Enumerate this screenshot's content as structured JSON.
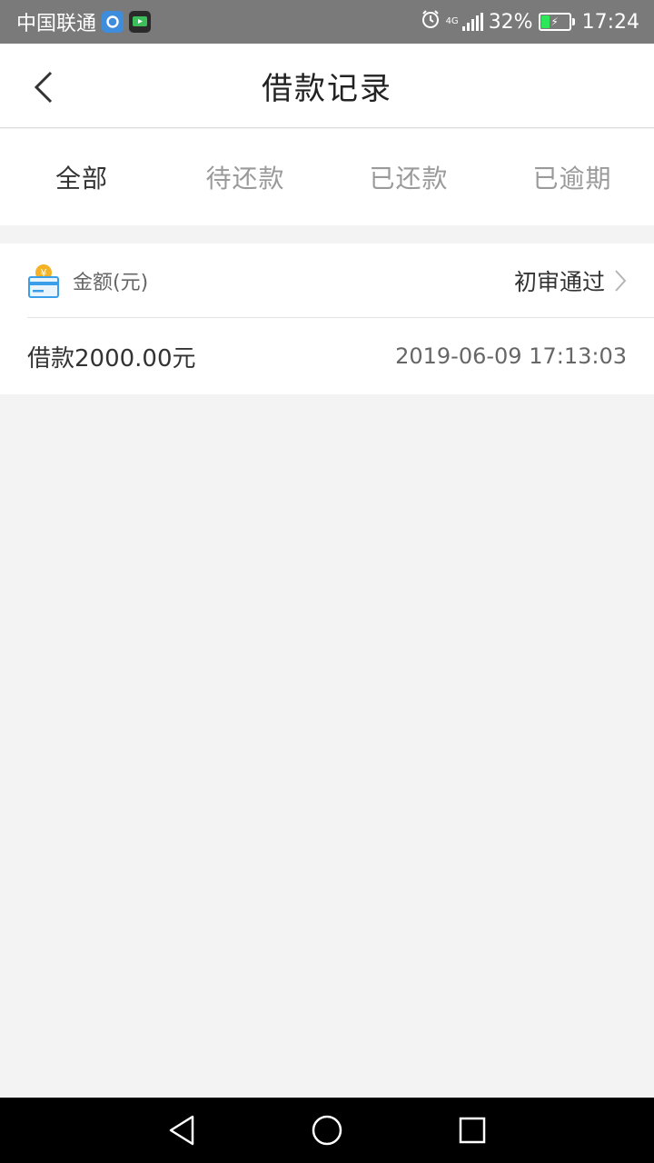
{
  "status_bar": {
    "carrier": "中国联通",
    "network": "4G",
    "battery": "32%",
    "battery_level": 0.32,
    "time": "17:24",
    "icons": [
      "app-browser-icon",
      "app-video-icon",
      "alarm-icon",
      "signal-icon",
      "battery-icon"
    ]
  },
  "header": {
    "title": "借款记录",
    "back_icon": "chevron-left-icon"
  },
  "tabs": [
    {
      "label": "全部",
      "active": true
    },
    {
      "label": "待还款",
      "active": false
    },
    {
      "label": "已还款",
      "active": false
    },
    {
      "label": "已逾期",
      "active": false
    }
  ],
  "records": [
    {
      "amount_label": "金额(元)",
      "status": "初审通过",
      "description": "借款2000.00元",
      "time": "2019-06-09 17:13:03",
      "icon": "money-card-icon"
    }
  ],
  "colors": {
    "status_bar": "#7a7a7a",
    "background": "#f3f3f3",
    "card_blue": "#3a9ee8",
    "coin_yellow": "#f5b225",
    "battery_green": "#2ee65a"
  },
  "system_nav": [
    "back-triangle-icon",
    "home-circle-icon",
    "recents-square-icon"
  ]
}
